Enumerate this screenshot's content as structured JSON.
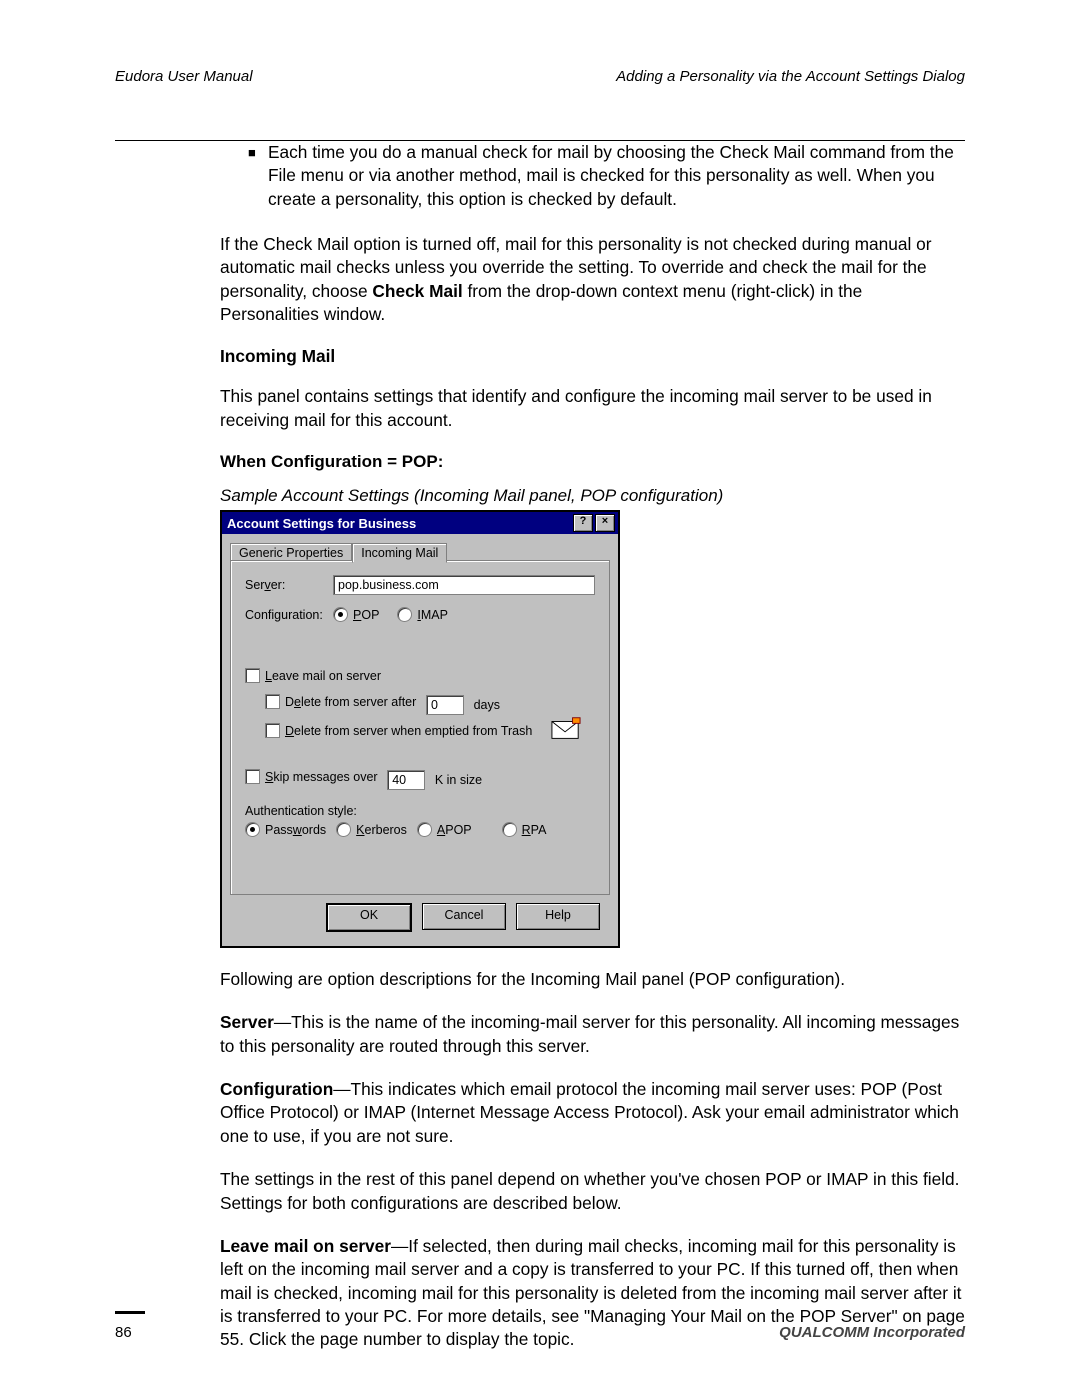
{
  "header": {
    "left": "Eudora User Manual",
    "right": "Adding a Personality via the Account Settings Dialog"
  },
  "body": {
    "bullet1": "Each time you do a manual check for mail by choosing the Check Mail command from the File menu or via another method, mail is checked for this personality as well. When you create a personality, this option is checked by default.",
    "para_checkmail_pre": "If the Check Mail option is turned off, mail for this personality is not checked during manual or automatic mail checks unless you override the setting. To override and check the mail for the personality, choose ",
    "para_checkmail_bold": "Check Mail",
    "para_checkmail_post": " from the drop-down context menu (right-click) in the Personalities window.",
    "heading_incoming": "Incoming Mail",
    "para_incoming_desc": "This panel contains settings that identify and configure the incoming mail server to be used in receiving mail for this account.",
    "heading_when_pop": "When Configuration = POP:",
    "caption_sample": "Sample Account Settings (Incoming Mail panel, POP configuration)",
    "para_following": "Following are option descriptions for the Incoming Mail panel (POP configuration).",
    "server_bold": "Server",
    "server_text": "—This is the name of the incoming-mail server for this personality. All incoming messages to this personality are routed through this server.",
    "config_bold": "Configuration",
    "config_text": "—This indicates which email protocol the incoming mail server uses: POP (Post Office Protocol) or IMAP (Internet Message Access Protocol). Ask your email administrator which one to use, if you are not sure.",
    "para_depend": "The settings in the rest of this panel depend on whether you've chosen POP or IMAP in this field. Settings for both configurations are described below.",
    "leave_bold": "Leave mail on server",
    "leave_text": "—If selected, then during mail checks, incoming mail for this personality is left on the incoming mail server and a copy is transferred to your PC. If this turned off, then when mail is checked, incoming mail for this personality is deleted from the incoming mail server after it is transferred to your PC. For more details, see \"Managing Your Mail on the POP Server\" on page 55. Click the page number to display the topic."
  },
  "dialog": {
    "title": "Account Settings for Business",
    "help_btn": "?",
    "close_btn": "×",
    "tab_generic": "Generic Properties",
    "tab_incoming": "Incoming Mail",
    "server_label": "Server:",
    "server_accel": "v",
    "server_value": "pop.business.com",
    "config_label": "Configuration:",
    "radio_pop": "POP",
    "radio_pop_accel": "P",
    "radio_imap": "IMAP",
    "radio_imap_accel": "I",
    "chk_leave": "Leave mail on server",
    "chk_leave_accel": "L",
    "chk_delete_after_pre": "Delete from server after",
    "chk_delete_after_accel": "e",
    "delete_days_value": "0",
    "delete_after_post": "days",
    "chk_delete_trash": "Delete from server when emptied from Trash",
    "chk_delete_trash_accel": "D",
    "chk_skip_pre": "Skip messages over",
    "chk_skip_accel": "S",
    "skip_value": "40",
    "skip_post": "K in size",
    "auth_label": "Authentication style:",
    "radio_passwords": "Passwords",
    "radio_passwords_accel": "w",
    "radio_kerberos": "Kerberos",
    "radio_kerberos_accel": "K",
    "radio_apop": "APOP",
    "radio_apop_accel": "A",
    "radio_rpa": "RPA",
    "radio_rpa_accel": "R",
    "btn_ok": "OK",
    "btn_cancel": "Cancel",
    "btn_help": "Help"
  },
  "footer": {
    "page_number": "86",
    "corporation": "QUALCOMM Incorporated"
  }
}
